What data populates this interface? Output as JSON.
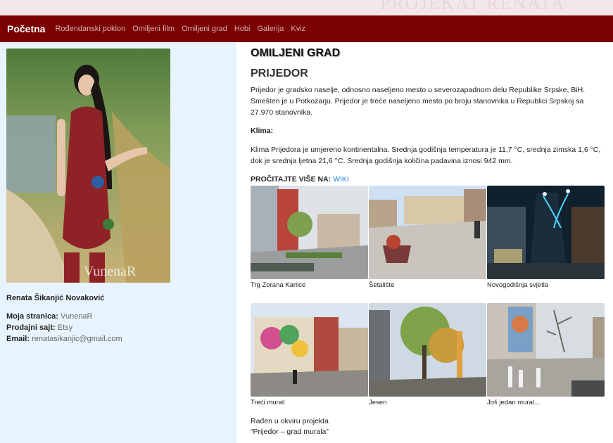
{
  "header_ghost_text": "PROJEKAT RENATA",
  "nav": {
    "brand": "Početna",
    "items": [
      "Rođendanski poklon",
      "Omiljeni film",
      "Omiljeni grad",
      "Hobi",
      "Galerija",
      "Kviz"
    ]
  },
  "sidebar": {
    "portrait_watermark": "VunenaR",
    "author_name": "Renata Šikanjić Novaković",
    "info": [
      {
        "label": "Moja stranica:",
        "value": "VunenaR"
      },
      {
        "label": "Prodajni sajt:",
        "value": "Etsy"
      },
      {
        "label": "Email:",
        "value": "renatasikanjic@gmail.com"
      }
    ]
  },
  "main": {
    "title": "OMILJENI GRAD",
    "city": "PRIJEDOR",
    "intro": "Prijedor je gradsko naselje, odnosno naseljeno mesto u severozapadnom delu Republike Srpske, BiH. Smešten je u Potkozarju. Prijedor je treće naseljeno mesto po broju stanovnika u Republici Srpskoj sa 27.970 stanovnika.",
    "klima_heading": "Klima:",
    "klima_text": "Klima Prijedora je umjereno kontinentalna. Srednja godišnja temperatura je 11,7 °C, srednja zimska 1,6 °C, dok je srednja ljetna 21,6 °C. Srednja godišnja količina padavina iznosi 942 mm.",
    "more_label": "PROČITAJTE VIŠE NA:",
    "more_link": "WIKI",
    "gallery": [
      {
        "caption": "Trg Zorana Karlice"
      },
      {
        "caption": "Šetalište"
      },
      {
        "caption": "Novogodišnja svjetla"
      },
      {
        "caption": "Treći mural:"
      },
      {
        "caption": "Jesen"
      },
      {
        "caption": "Još jedan mural..."
      }
    ],
    "footer_line1": "Rađen u okviru projekta",
    "footer_line2": "“Prijedor – grad murala”"
  },
  "colors": {
    "navbar": "#7b0000",
    "sidebar_bg": "#e8f4fd",
    "link": "#1a7bd6"
  }
}
